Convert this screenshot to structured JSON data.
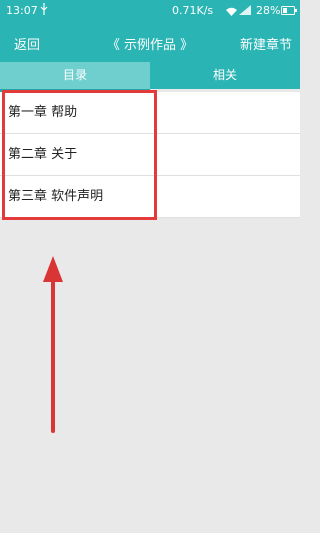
{
  "status_bar": {
    "time": "13:07",
    "network_speed": "0.71K/s",
    "battery_percent": "28%",
    "icons": [
      "usb-icon",
      "wifi-icon",
      "signal-icon",
      "battery-icon"
    ]
  },
  "title_bar": {
    "back_label": "返回",
    "title": "《 示例作品 》",
    "new_chapter_label": "新建章节"
  },
  "tabs": [
    {
      "label": "目录",
      "active": true
    },
    {
      "label": "相关",
      "active": false
    }
  ],
  "chapters": [
    {
      "label": "第一章 帮助"
    },
    {
      "label": "第二章 关于"
    },
    {
      "label": "第三章 软件声明"
    }
  ],
  "colors": {
    "header": "#2bb4b4",
    "active_tab": "#6fcfcf",
    "annotation": "#e33b3b",
    "background": "#e9e9e9"
  }
}
